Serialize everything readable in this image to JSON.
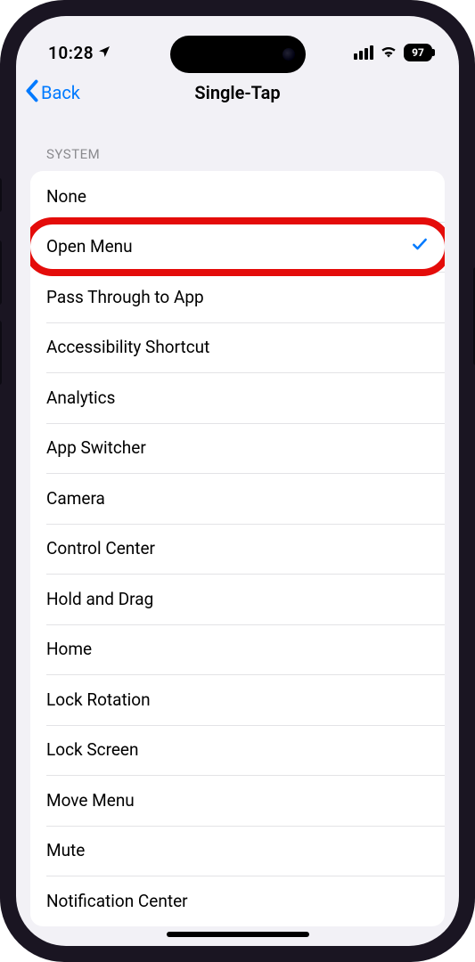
{
  "status": {
    "time": "10:28",
    "battery": "97"
  },
  "nav": {
    "back_label": "Back",
    "title": "Single-Tap"
  },
  "section": {
    "header": "SYSTEM"
  },
  "options": [
    {
      "label": "None",
      "selected": false,
      "highlighted": false
    },
    {
      "label": "Open Menu",
      "selected": true,
      "highlighted": true
    },
    {
      "label": "Pass Through to App",
      "selected": false,
      "highlighted": false
    },
    {
      "label": "Accessibility Shortcut",
      "selected": false,
      "highlighted": false
    },
    {
      "label": "Analytics",
      "selected": false,
      "highlighted": false
    },
    {
      "label": "App Switcher",
      "selected": false,
      "highlighted": false
    },
    {
      "label": "Camera",
      "selected": false,
      "highlighted": false
    },
    {
      "label": "Control Center",
      "selected": false,
      "highlighted": false
    },
    {
      "label": "Hold and Drag",
      "selected": false,
      "highlighted": false
    },
    {
      "label": "Home",
      "selected": false,
      "highlighted": false
    },
    {
      "label": "Lock Rotation",
      "selected": false,
      "highlighted": false
    },
    {
      "label": "Lock Screen",
      "selected": false,
      "highlighted": false
    },
    {
      "label": "Move Menu",
      "selected": false,
      "highlighted": false
    },
    {
      "label": "Mute",
      "selected": false,
      "highlighted": false
    },
    {
      "label": "Notification Center",
      "selected": false,
      "highlighted": false
    }
  ]
}
